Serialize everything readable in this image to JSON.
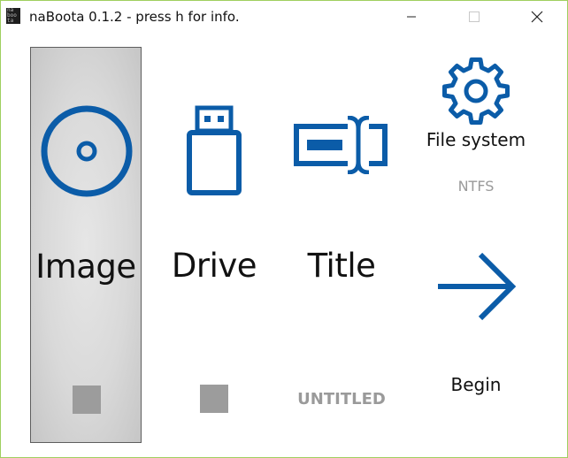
{
  "window": {
    "title": "naBoota 0.1.2 - press h for info.",
    "app_icon_text": [
      "na",
      "boo",
      "ta"
    ]
  },
  "colors": {
    "accent": "#0b5ca8",
    "selected_panel": "#d9d9d9",
    "muted_text": "#9a9a9a",
    "square": "#9c9c9c"
  },
  "panels": {
    "image": {
      "label": "Image",
      "icon": "disc-icon",
      "selected": true
    },
    "drive": {
      "label": "Drive",
      "icon": "usb-drive-icon"
    },
    "title": {
      "label": "Title",
      "value": "UNTITLED",
      "icon": "text-cursor-field-icon"
    },
    "file_system": {
      "label": "File system",
      "value": "NTFS",
      "icon": "gear-icon"
    },
    "begin": {
      "label": "Begin",
      "icon": "arrow-right-icon"
    }
  }
}
